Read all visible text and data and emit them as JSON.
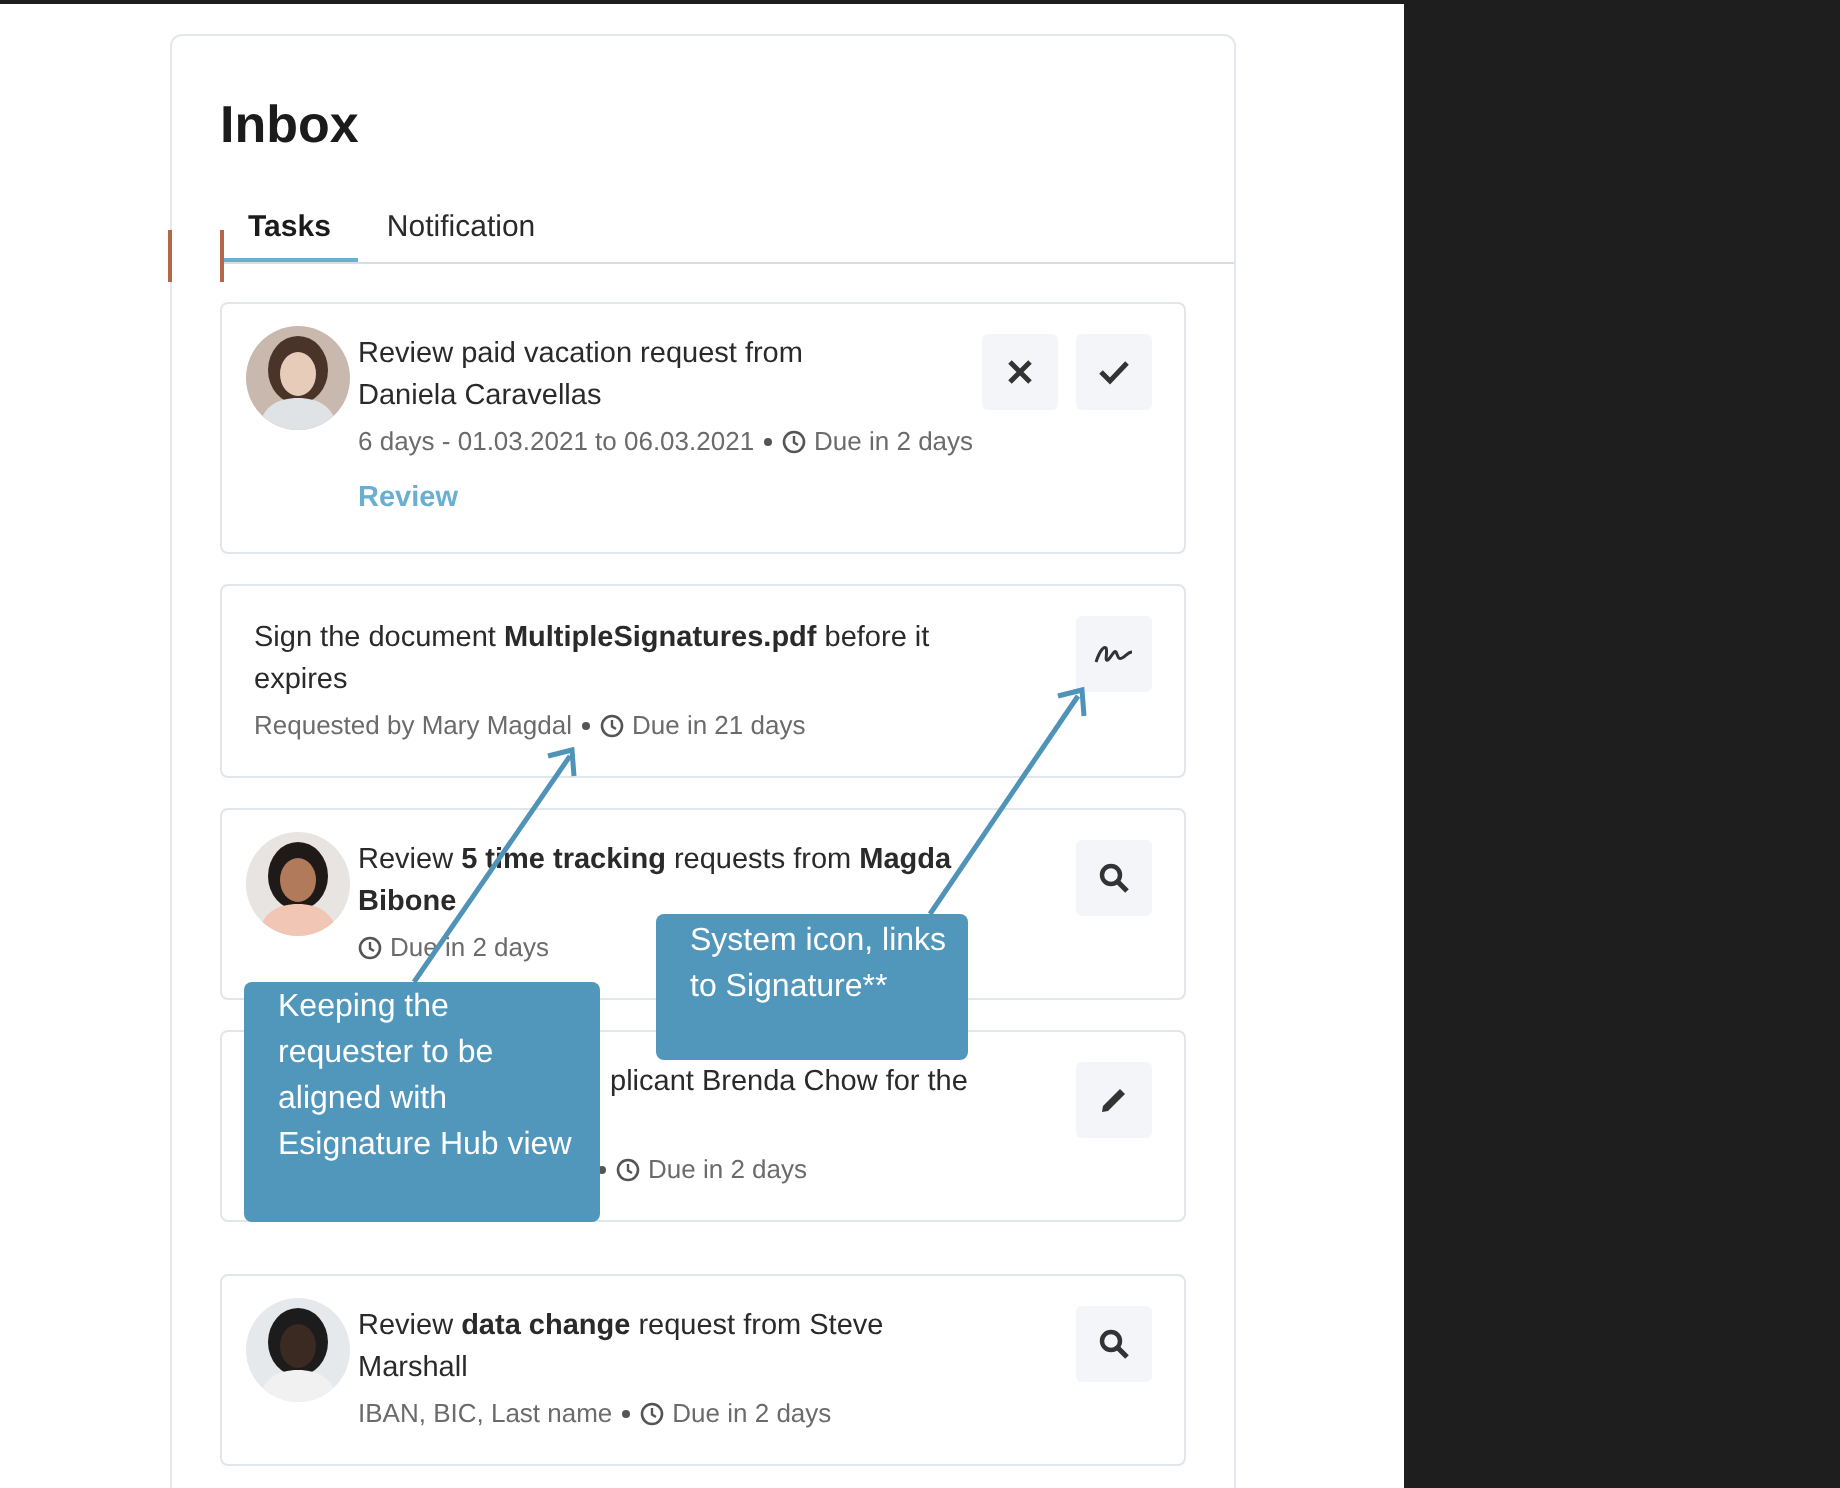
{
  "title": "Inbox",
  "tabs": [
    {
      "label": "Tasks",
      "selected": true
    },
    {
      "label": "Notification",
      "selected": false
    }
  ],
  "tasks": [
    {
      "title": "Review paid vacation request from Daniela Caravellas",
      "meta": "6 days - 01.03.2021 to 06.03.2021",
      "due": "Due in 2 days",
      "link": "Review",
      "actions": [
        {
          "kind": "reject"
        },
        {
          "kind": "approve"
        }
      ]
    },
    {
      "kind": "text",
      "title": "Sign the document **MultipleSignatures.pdf** before it expires",
      "meta": "Requested by Mary Magdal",
      "due": "Due in 21 days",
      "actions": [
        {
          "kind": "sign"
        }
      ]
    },
    {
      "title": "Review **5 time tracking** requests from **Magda Bibone**",
      "due": "Due in 2 days",
      "actions": [
        {
          "kind": "search"
        }
      ]
    },
    {
      "kind": "covered",
      "title": "plicant Brenda Chow for the",
      "due": "Due in 2 days",
      "actions": [
        {
          "kind": "edit"
        }
      ]
    },
    {
      "title": "Review **data change** request from Steve Marshall",
      "meta": "IBAN, BIC, Last name",
      "due": "Due in 2 days",
      "actions": [
        {
          "kind": "search"
        }
      ]
    }
  ],
  "callouts": [
    {
      "text": "Keeping the requester to be aligned with Esignature Hub view"
    },
    {
      "text": "System icon, links to Signature**"
    }
  ]
}
